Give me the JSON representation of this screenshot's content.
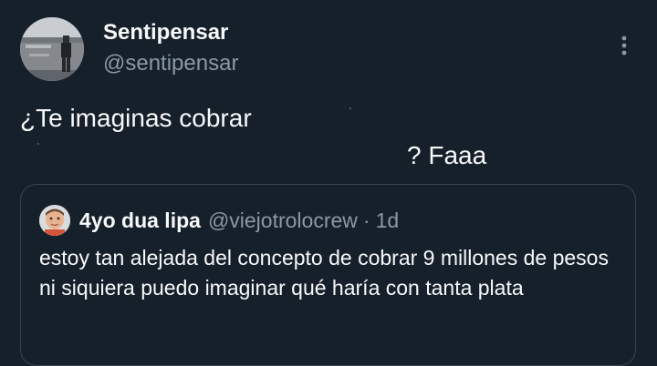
{
  "tweet": {
    "display_name": "Sentipensar",
    "handle": "@sentipensar",
    "text_line1": "¿Te imaginas cobrar",
    "text_line2": "? Faaa",
    "more_icon": "more-vertical-icon"
  },
  "quoted_tweet": {
    "display_name": "4yo dua lipa",
    "handle": "@viejotrolocrew",
    "separator": "·",
    "time": "1d",
    "text": "estoy tan alejada del concepto de cobrar 9 millones de pesos ni siquiera puedo imaginar qué haría con tanta plata"
  },
  "colors": {
    "background": "#15202b",
    "primary_text": "#f7f9f9",
    "secondary_text": "#8b98a5",
    "border": "#38444d"
  }
}
